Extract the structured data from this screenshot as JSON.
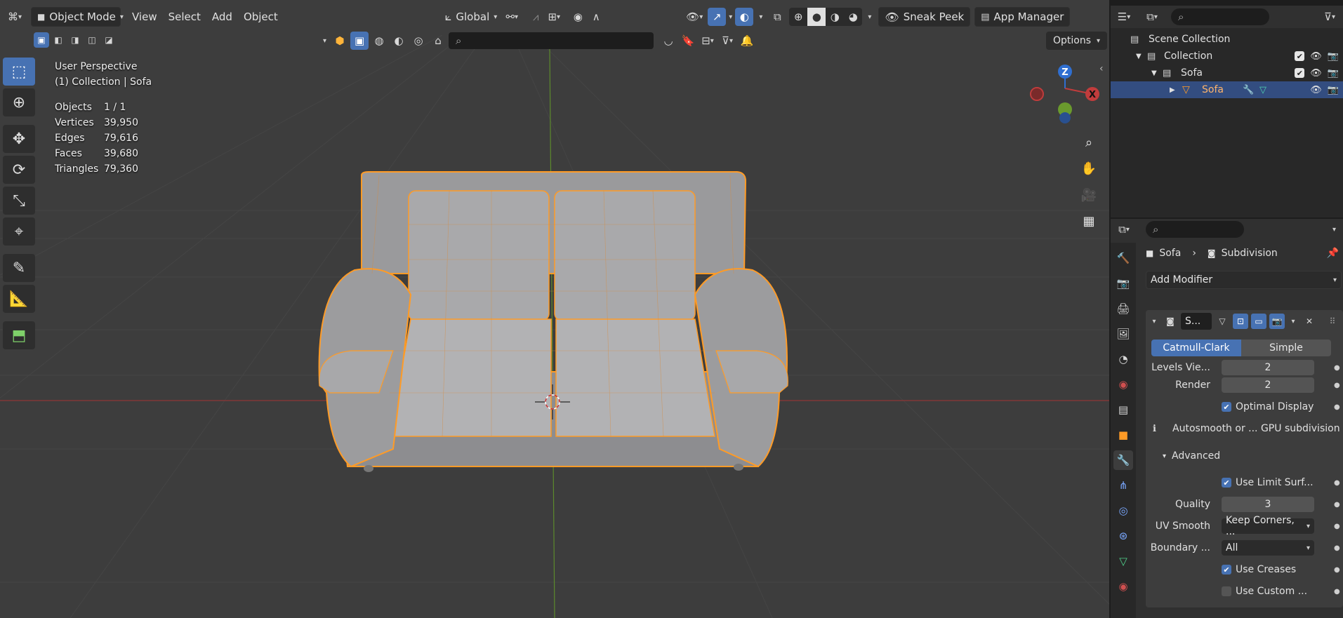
{
  "viewport": {
    "mode": "Object Mode",
    "menus": [
      "View",
      "Select",
      "Add",
      "Object"
    ],
    "orientation": "Global",
    "sneak_peek": "Sneak Peek",
    "app_manager": "App Manager",
    "options": "Options",
    "view_name": "User Perspective",
    "collection_label": "(1) Collection | Sofa",
    "stats": [
      {
        "label": "Objects",
        "value": "1 / 1"
      },
      {
        "label": "Vertices",
        "value": "39,950"
      },
      {
        "label": "Edges",
        "value": "79,616"
      },
      {
        "label": "Faces",
        "value": "39,680"
      },
      {
        "label": "Triangles",
        "value": "79,360"
      }
    ],
    "gizmo": {
      "z": "Z",
      "x": "X"
    },
    "colors": {
      "x_axis": "#c13c3c",
      "y_axis": "#6a9a2d",
      "z_axis": "#2f6fd1",
      "selection": "#ff9b26",
      "active_blue": "#4772b3"
    }
  },
  "outliner": {
    "items": [
      {
        "label": "Scene Collection"
      },
      {
        "label": "Collection"
      },
      {
        "label": "Sofa"
      },
      {
        "label": "Sofa"
      }
    ]
  },
  "properties": {
    "breadcrumb_object": "Sofa",
    "breadcrumb_modifier": "Subdivision",
    "add_modifier": "Add Modifier",
    "modifier_short_name": "S...",
    "mode_a": "Catmull-Clark",
    "mode_b": "Simple",
    "levels_viewport_label": "Levels Vie...",
    "levels_viewport_value": "2",
    "render_label": "Render",
    "render_value": "2",
    "optimal_display": "Optimal Display",
    "autosmooth_note": "Autosmooth or ... GPU subdivision",
    "advanced": "Advanced",
    "use_limit_surface": "Use Limit Surf...",
    "quality_label": "Quality",
    "quality_value": "3",
    "uv_smooth_label": "UV Smooth",
    "uv_smooth_value": "Keep Corners, ...",
    "boundary_label": "Boundary ...",
    "boundary_value": "All",
    "use_creases": "Use Creases",
    "use_custom": "Use Custom ..."
  }
}
